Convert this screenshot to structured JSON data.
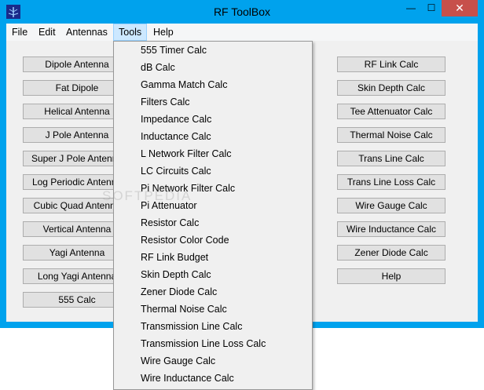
{
  "window": {
    "title": "RF ToolBox",
    "controls": {
      "minimize": "—",
      "maximize": "☐",
      "close": "✕"
    }
  },
  "menubar": {
    "items": [
      "File",
      "Edit",
      "Antennas",
      "Tools",
      "Help"
    ],
    "active": "Tools"
  },
  "left_buttons": [
    "Dipole Antenna",
    "Fat Dipole",
    "Helical Antenna",
    "J Pole Antenna",
    "Super J Pole Antenna",
    "Log Periodic Antenna",
    "Cubic Quad Antenna",
    "Vertical Antenna",
    "Yagi Antenna",
    "Long Yagi Antenna",
    "555 Calc"
  ],
  "right_buttons": [
    "RF Link Calc",
    "Skin Depth Calc",
    "Tee Attenuator Calc",
    "Thermal Noise Calc",
    "Trans Line Calc",
    "Trans Line Loss Calc",
    "Wire Gauge Calc",
    "Wire Inductance Calc",
    "Zener Diode Calc",
    "Help"
  ],
  "tools_menu": [
    "555 Timer Calc",
    "dB Calc",
    "Gamma Match Calc",
    "Filters Calc",
    "Impedance Calc",
    "Inductance Calc",
    "L Network Filter Calc",
    "LC Circuits Calc",
    "Pi Network Filter Calc",
    "Pi Attenuator",
    "Resistor Calc",
    "Resistor Color Code",
    "RF Link Budget",
    "Skin Depth Calc",
    "Zener Diode Calc",
    "Thermal Noise Calc",
    "Transmission Line Calc",
    "Transmission Line Loss Calc",
    "Wire Gauge Calc",
    "Wire Inductance Calc"
  ],
  "watermark": "SOFTPEDIA",
  "colors": {
    "titlebar": "#00a2ed",
    "close": "#c7504b",
    "menu_highlight": "#cce8ff"
  }
}
